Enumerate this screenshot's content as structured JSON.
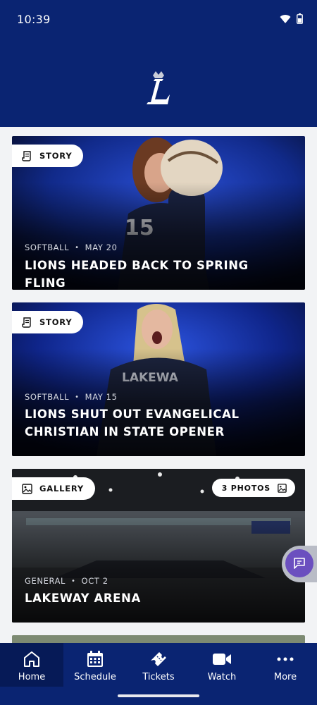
{
  "status_bar": {
    "time": "10:39"
  },
  "feed": {
    "cards": [
      {
        "type_label": "STORY",
        "category": "SOFTBALL",
        "date": "MAY 20",
        "headline": "LIONS HEADED BACK TO SPRING FLING"
      },
      {
        "type_label": "STORY",
        "category": "SOFTBALL",
        "date": "MAY 15",
        "headline": "LIONS SHUT OUT EVANGELICAL CHRISTIAN IN STATE OPENER"
      },
      {
        "type_label": "GALLERY",
        "photo_count": "3 PHOTOS",
        "category": "GENERAL",
        "date": "OCT 2",
        "headline": "LAKEWAY ARENA"
      }
    ]
  },
  "tabs": [
    {
      "label": "Home",
      "icon": "home-icon",
      "active": true
    },
    {
      "label": "Schedule",
      "icon": "calendar-icon",
      "active": false
    },
    {
      "label": "Tickets",
      "icon": "ticket-icon",
      "active": false
    },
    {
      "label": "Watch",
      "icon": "video-camera-icon",
      "active": false
    },
    {
      "label": "More",
      "icon": "more-dots-icon",
      "active": false
    }
  ],
  "colors": {
    "brand_navy": "#0a2472",
    "active_tab": "#061a57",
    "chat_purple": "#6b4fbf"
  }
}
